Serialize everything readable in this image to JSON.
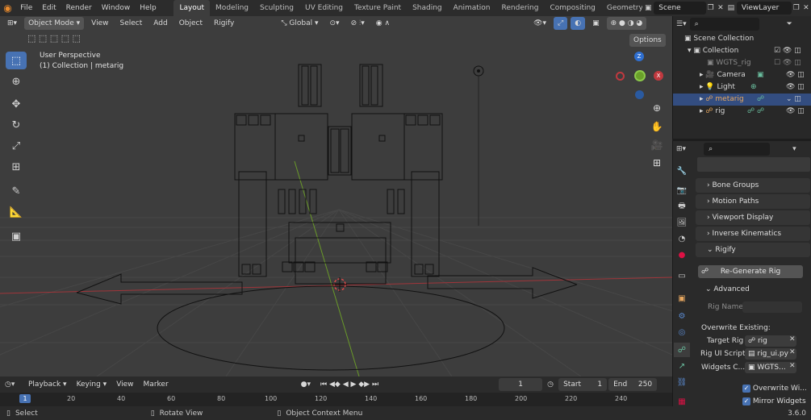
{
  "menu": {
    "file": "File",
    "edit": "Edit",
    "render": "Render",
    "window": "Window",
    "help": "Help"
  },
  "workspaces": [
    "Layout",
    "Modeling",
    "Sculpting",
    "UV Editing",
    "Texture Paint",
    "Shading",
    "Animation",
    "Rendering",
    "Compositing",
    "Geometry Noc"
  ],
  "scene": {
    "name": "Scene",
    "view_layer": "ViewLayer"
  },
  "viewport": {
    "mode": "Object Mode",
    "menus": [
      "View",
      "Select",
      "Add",
      "Object",
      "Rigify"
    ],
    "orientation": "Global",
    "options": "Options",
    "perspective": "User Perspective",
    "collection_info": "(1) Collection | metarig"
  },
  "outliner": {
    "scene_collection": "Scene Collection",
    "items": [
      "Collection",
      "WGTS_rig",
      "Camera",
      "Light",
      "metarig",
      "rig"
    ]
  },
  "properties": {
    "panels": {
      "bone_groups": "Bone Groups",
      "motion_paths": "Motion Paths",
      "viewport_display": "Viewport Display",
      "inverse_kinematics": "Inverse Kinematics",
      "rigify": "Rigify"
    },
    "regenerate": "Re-Generate Rig",
    "advanced": "Advanced",
    "rig_name_label": "Rig Name",
    "overwrite_label": "Overwrite Existing:",
    "target_rig_label": "Target Rig",
    "target_rig_value": "rig",
    "rig_ui_label": "Rig UI Script",
    "rig_ui_value": "rig_ui.py",
    "widgets_label": "Widgets C...",
    "widgets_value": "WGTS...",
    "mirror_widgets": "Mirror Widgets",
    "overwrite_widgets": "Overwrite Wi..."
  },
  "timeline": {
    "menus": [
      "Playback",
      "Keying",
      "View",
      "Marker"
    ],
    "current_frame": "1",
    "start_label": "Start",
    "start": "1",
    "end_label": "End",
    "end": "250",
    "ticks": [
      "1",
      "20",
      "40",
      "60",
      "80",
      "100",
      "120",
      "140",
      "160",
      "180",
      "200",
      "220",
      "240"
    ]
  },
  "status": {
    "select": "Select",
    "rotate": "Rotate View",
    "context": "Object Context Menu",
    "version": "3.6.0"
  }
}
